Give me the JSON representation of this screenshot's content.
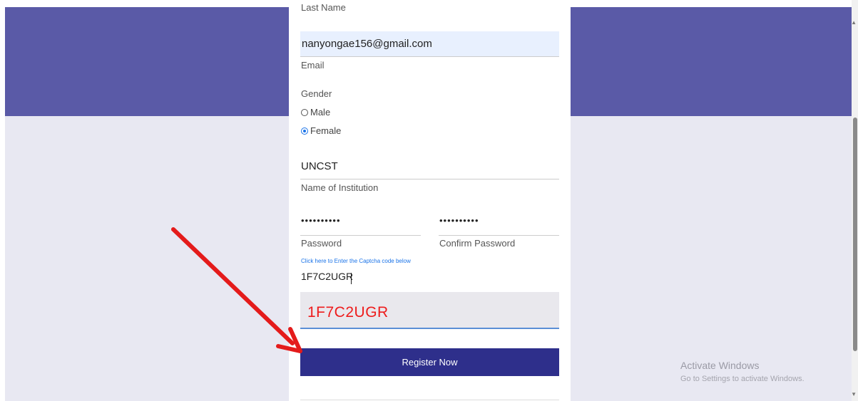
{
  "form": {
    "last_name_label": "Last Name",
    "email_value": "nanyongae156@gmail.com",
    "email_label": "Email",
    "gender_label": "Gender",
    "gender_options": [
      "Male",
      "Female"
    ],
    "gender_selected": "Female",
    "institution_value": "UNCST",
    "institution_label": "Name of Institution",
    "password_value": "••••••••••",
    "password_label": "Password",
    "confirm_password_value": "••••••••••",
    "confirm_password_label": "Confirm Password",
    "captcha_hint": "Click here to Enter the Captcha code below",
    "captcha_input_value": "1F7C2UGR",
    "captcha_code": "1F7C2UGR",
    "register_label": "Register Now"
  },
  "watermark": {
    "title": "Activate Windows",
    "subtitle": "Go to Settings to activate Windows."
  },
  "colors": {
    "header_band": "#5a5aa7",
    "page_bg": "#e8e8f2",
    "button": "#2e2f8b",
    "captcha_text": "#ee1c1c",
    "annotation_arrow": "#e41b1b"
  }
}
